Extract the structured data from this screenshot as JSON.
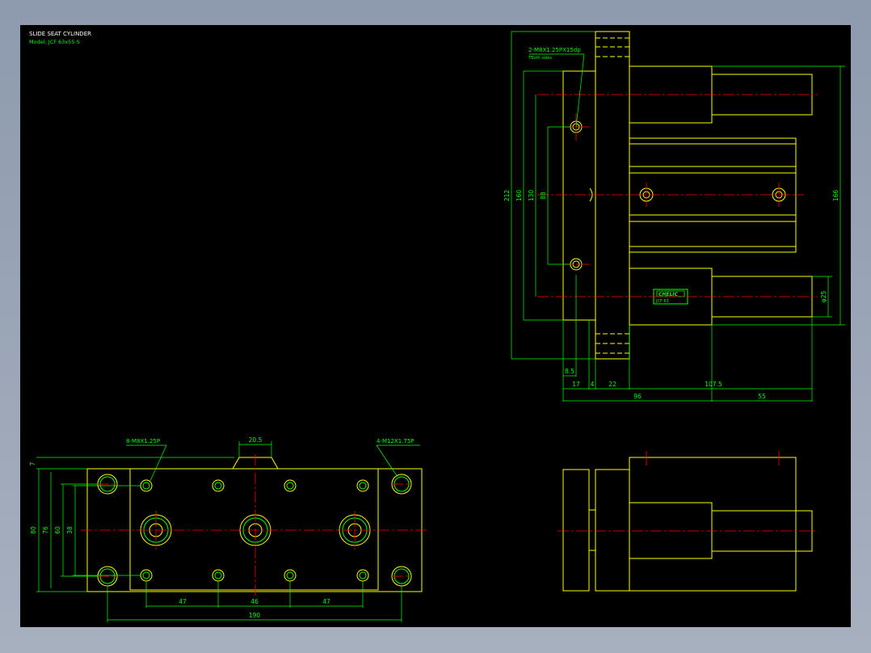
{
  "title_block": {
    "title": "SLIDE SEAT CYLINDER",
    "model": "Model: JCF 63x55-S"
  },
  "logo": {
    "brand": "CHELIC",
    "sub": "JCF 63"
  },
  "callouts": {
    "side_tap": "2-M8X1.25PX15dp",
    "side_tap_sub": "TBoth sides",
    "top_tap": "8-M8X1.25P",
    "corner_tap": "4-M12X1.75P"
  },
  "dims": {
    "d212": "212",
    "d160": "160",
    "d130": "130",
    "d88": "88",
    "d166": "166",
    "phi25": "φ25",
    "d8_5": "8.5",
    "d17": "17",
    "d4": "4",
    "d22": "22",
    "d107_5": "107.5",
    "d96": "96",
    "d55": "55",
    "d20_5": "20.5",
    "d7": "7",
    "d80": "80",
    "d76": "76",
    "d60": "60",
    "d38": "38",
    "d47a": "47",
    "d46": "46",
    "d47b": "47",
    "d190": "190"
  },
  "colors": {
    "background": "#000000",
    "outline": "#ffff00",
    "dimension": "#00ff00",
    "centerline": "#ff0000",
    "title": "#ffffff"
  }
}
